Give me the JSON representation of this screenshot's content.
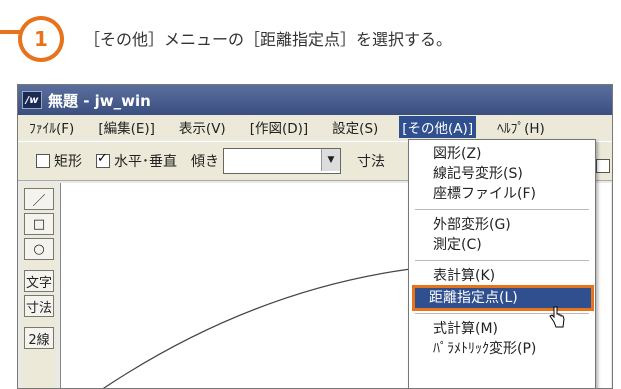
{
  "step": {
    "number": "1",
    "instruction": "［その他］メニューの［距離指定点］を選択する。"
  },
  "window": {
    "title": "無題 - jw_win",
    "icon_label": "/w"
  },
  "menubar": {
    "items": [
      "ﾌｧｲﾙ(F)",
      "[編集(E)]",
      "表示(V)",
      "[作図(D)]",
      "設定(S)",
      "[その他(A)]",
      "ﾍﾙﾌﾟ(H)"
    ]
  },
  "toolbar": {
    "rect_label": "矩形",
    "hv_label": "水平･垂直",
    "slope_label": "傾き",
    "dim_label": "寸法"
  },
  "tools": [
    "／",
    "□",
    "○",
    "文字",
    "寸法",
    "2線"
  ],
  "dropdown": {
    "items": [
      "図形(Z)",
      "線記号変形(S)",
      "座標ファイル(F)",
      "外部変形(G)",
      "測定(C)",
      "表計算(K)",
      "距離指定点(L)",
      "式計算(M)",
      "ﾊﾟﾗﾒﾄﾘｯｸ変形(P)"
    ]
  },
  "colors": {
    "accent": "#e8731d",
    "highlight": "#2f4f8f"
  }
}
